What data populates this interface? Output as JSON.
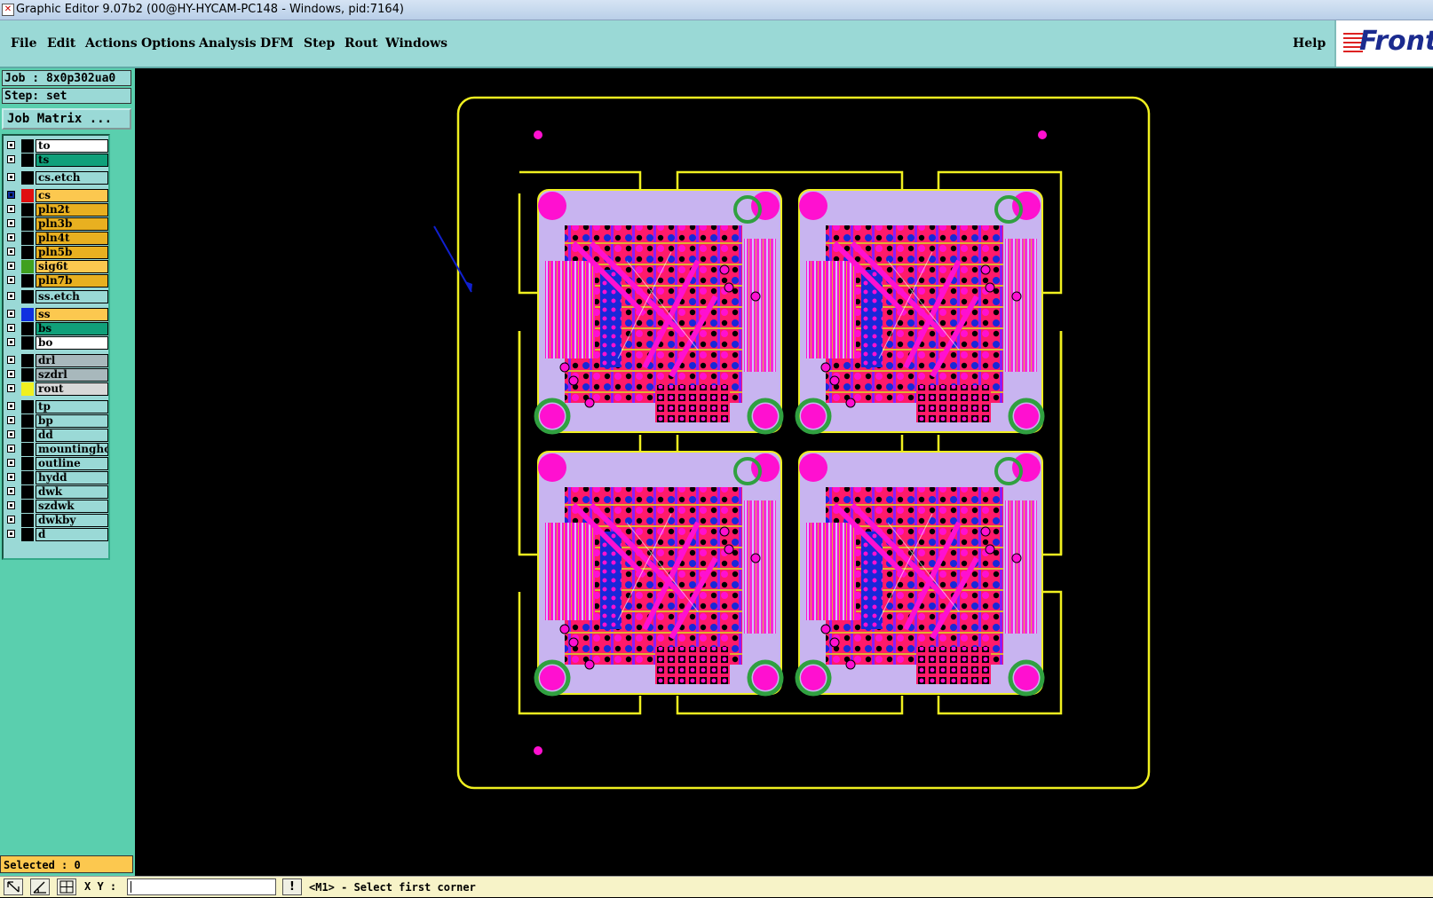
{
  "window": {
    "title": "Graphic Editor 9.07b2 (00@HY-HYCAM-PC148 - Windows, pid:7164)"
  },
  "menu": {
    "items": [
      "File",
      "Edit",
      "Actions",
      "Options",
      "Analysis",
      "DFM",
      "Step",
      "Rout",
      "Windows"
    ],
    "help": "Help",
    "logo": "Front"
  },
  "job": {
    "job_label": "Job : 8x0p302ua0",
    "step_label": "Step: set",
    "matrix_button": "Job Matrix ..."
  },
  "layers": [
    {
      "name": "to",
      "bg": "#ffffff",
      "swatch": "#000000"
    },
    {
      "name": "ts",
      "bg": "#10a07a",
      "swatch": "#000000"
    },
    {
      "name": "cs.etch",
      "bg": "#9ad9d6",
      "swatch": "#000000"
    },
    {
      "name": "cs",
      "bg": "#fcc84f",
      "swatch": "#e01010",
      "active": true
    },
    {
      "name": "pln2t",
      "bg": "#e8b020",
      "swatch": "#000000"
    },
    {
      "name": "pln3b",
      "bg": "#e8b020",
      "swatch": "#000000"
    },
    {
      "name": "pln4t",
      "bg": "#e8b020",
      "swatch": "#000000"
    },
    {
      "name": "pln5b",
      "bg": "#e8b020",
      "swatch": "#000000"
    },
    {
      "name": "sig6t",
      "bg": "#fcc84f",
      "swatch": "#40a020"
    },
    {
      "name": "pln7b",
      "bg": "#e8b020",
      "swatch": "#000000"
    },
    {
      "name": "ss.etch",
      "bg": "#9ad9d6",
      "swatch": "#000000"
    },
    {
      "name": "ss",
      "bg": "#fcc84f",
      "swatch": "#1030e0"
    },
    {
      "name": "bs",
      "bg": "#10a07a",
      "swatch": "#000000"
    },
    {
      "name": "bo",
      "bg": "#ffffff",
      "swatch": "#000000"
    },
    {
      "name": "drl",
      "bg": "#a8b8bc",
      "swatch": "#000000"
    },
    {
      "name": "szdrl",
      "bg": "#a8b8bc",
      "swatch": "#000000"
    },
    {
      "name": "rout",
      "bg": "#d8d8d8",
      "swatch": "#f0f020"
    },
    {
      "name": "tp",
      "bg": "#9ad9d6",
      "swatch": "#000000"
    },
    {
      "name": "bp",
      "bg": "#9ad9d6",
      "swatch": "#000000"
    },
    {
      "name": "dd",
      "bg": "#9ad9d6",
      "swatch": "#000000"
    },
    {
      "name": "mountinghole",
      "bg": "#9ad9d6",
      "swatch": "#000000"
    },
    {
      "name": "outline",
      "bg": "#9ad9d6",
      "swatch": "#000000"
    },
    {
      "name": "hydd",
      "bg": "#9ad9d6",
      "swatch": "#000000"
    },
    {
      "name": "dwk",
      "bg": "#9ad9d6",
      "swatch": "#000000"
    },
    {
      "name": "szdwk",
      "bg": "#9ad9d6",
      "swatch": "#000000"
    },
    {
      "name": "dwkby",
      "bg": "#9ad9d6",
      "swatch": "#000000"
    },
    {
      "name": "d",
      "bg": "#9ad9d6",
      "swatch": "#000000"
    }
  ],
  "status": {
    "selected": "Selected : 0",
    "xy_label": "X Y :",
    "xy_value": "",
    "message": "<M1> - Select first corner"
  },
  "colors": {
    "rout": "#f0f020",
    "pad": "#ff10d0",
    "copper": "#ff1a6a",
    "board_fill": "#c8b4f0",
    "blue_trace": "#1828d8",
    "green_ring": "#30a040"
  }
}
